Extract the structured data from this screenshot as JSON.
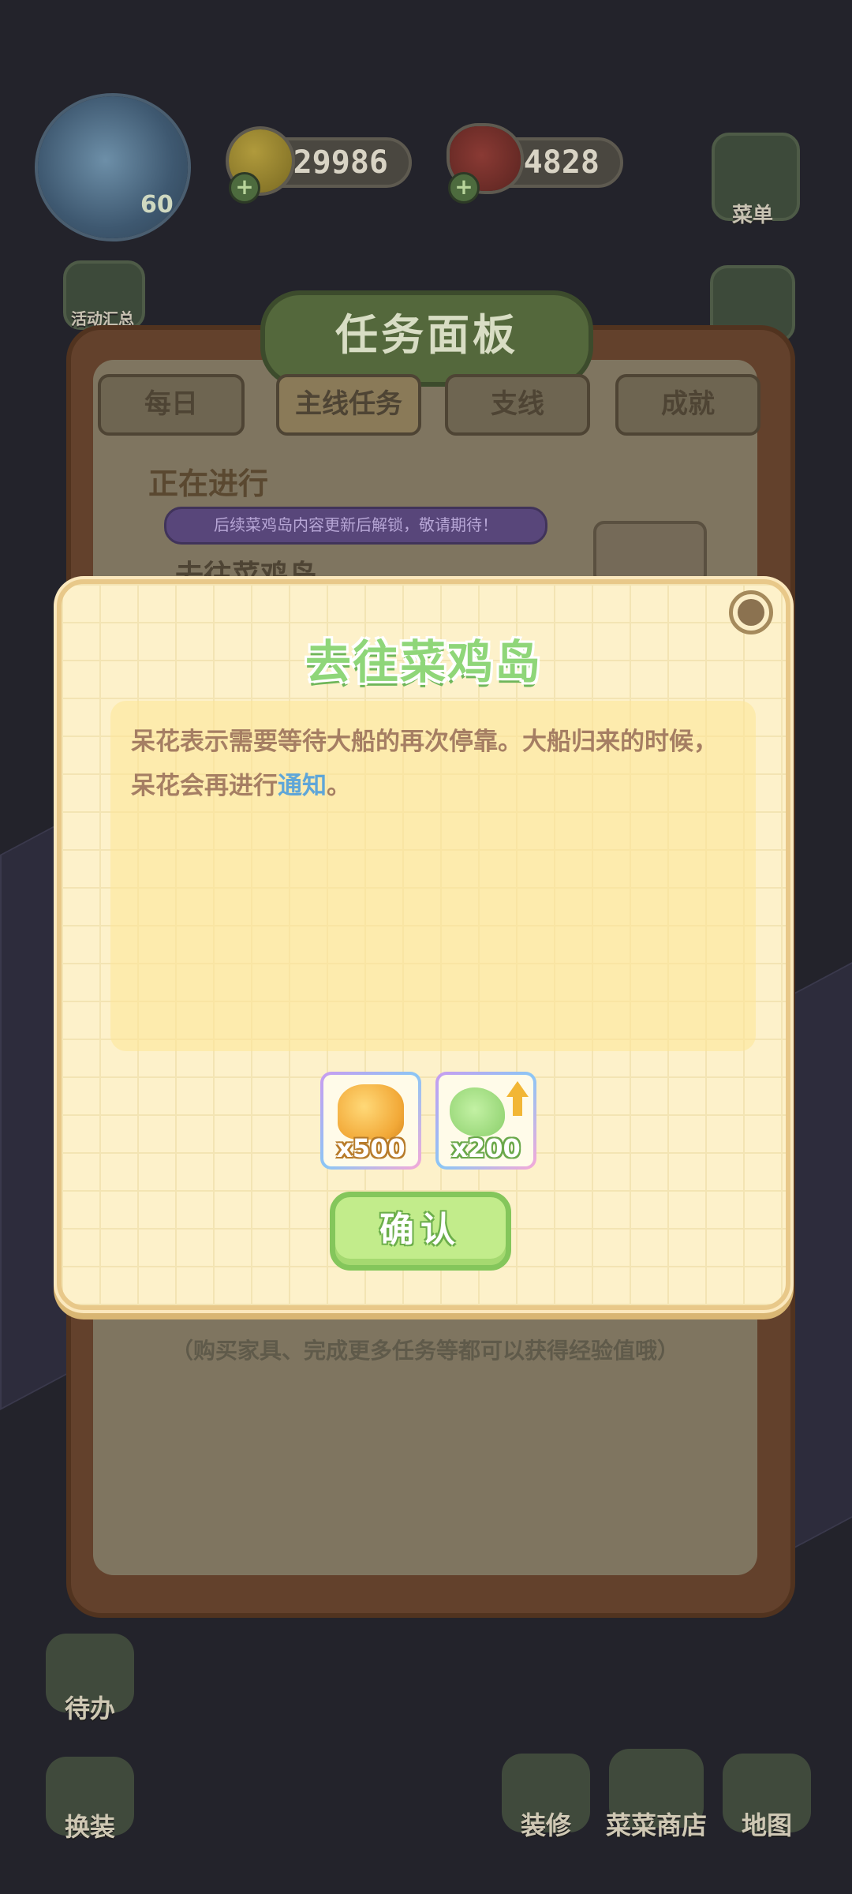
{
  "hud": {
    "level": "60",
    "coins": "29986",
    "food": "4828",
    "menu_label": "菜单",
    "events_label": "活动汇总"
  },
  "task_panel": {
    "title": "任务面板",
    "tabs": [
      "每日",
      "主线任务",
      "支线",
      "成就"
    ],
    "active_tab": "主线任务",
    "section": "正在进行",
    "notice": "后续菜鸡岛内容更新后解锁，敬请期待！",
    "task_name": "去往菜鸡岛",
    "footer_hint": "（购买家具、完成更多任务等都可以获得经验值哦）"
  },
  "bottom_bar": {
    "todo": "待办",
    "outfit": "换装",
    "decorate": "装修",
    "shop": "菜菜商店",
    "map": "地图"
  },
  "modal": {
    "title": "去往菜鸡岛",
    "desc_part1": "呆花表示需要等待大船的再次停靠。大船归来的时候，呆花会再进行",
    "desc_link": "通知",
    "desc_part2": "。",
    "rewards": [
      {
        "icon": "coin-pile-icon",
        "qty": "x500"
      },
      {
        "icon": "exp-leaf-icon",
        "qty": "x200"
      }
    ],
    "confirm_label": "确认"
  },
  "colors": {
    "title_green": "#8fd679",
    "confirm_bg": "#c2ec8b",
    "link_blue": "#5fa6d8",
    "modal_bg": "#fdf1ca"
  }
}
